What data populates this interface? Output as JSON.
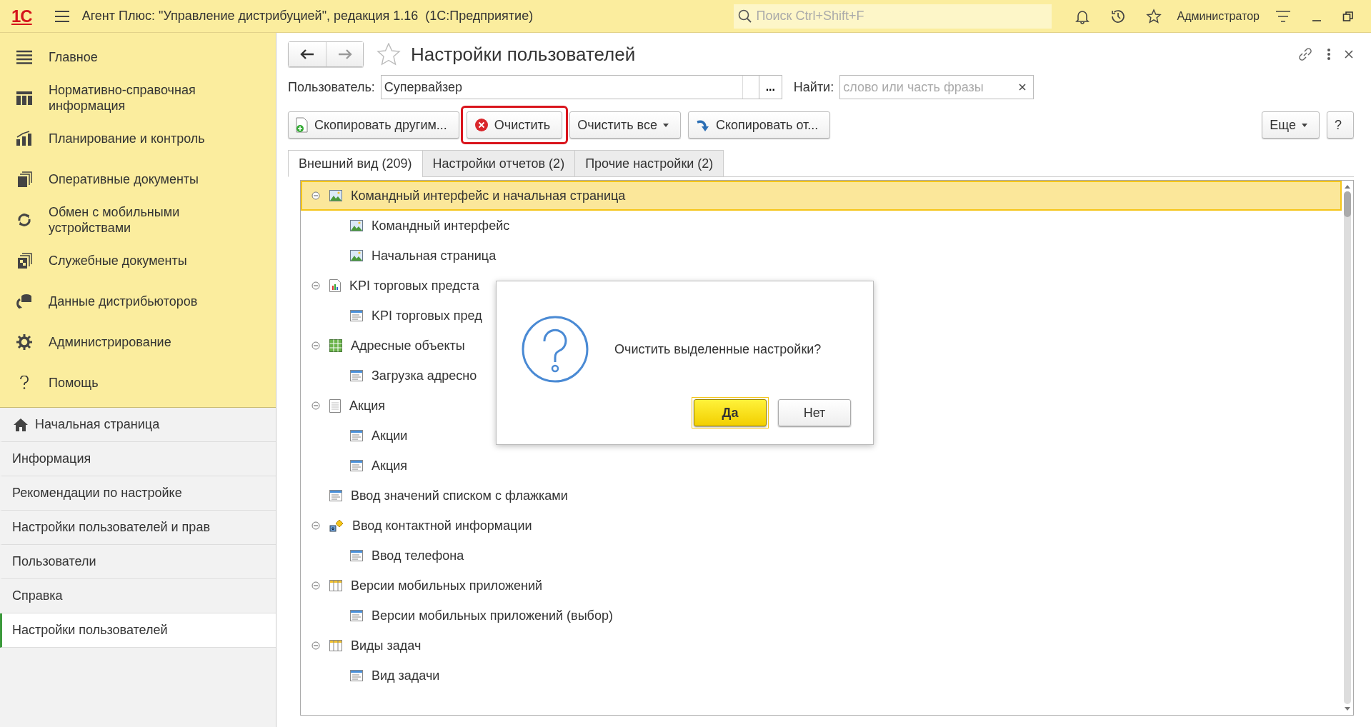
{
  "topbar": {
    "logo": "1С",
    "title": "Агент Плюс: \"Управление дистрибуцией\", редакция 1.16  (1С:Предприятие)",
    "search_placeholder": "Поиск Ctrl+Shift+F",
    "user": "Администратор"
  },
  "sections": [
    {
      "label": "Главное",
      "kind": "menu"
    },
    {
      "label": "Нормативно-справочная информация",
      "kind": "catalog"
    },
    {
      "label": "Планирование и контроль",
      "kind": "chart"
    },
    {
      "label": "Оперативные документы",
      "kind": "docs"
    },
    {
      "label": "Обмен с мобильными устройствами",
      "kind": "sync"
    },
    {
      "label": "Служебные документы",
      "kind": "service"
    },
    {
      "label": "Данные дистрибьюторов",
      "kind": "data"
    },
    {
      "label": "Администрирование",
      "kind": "gear"
    },
    {
      "label": "Помощь",
      "kind": "help"
    }
  ],
  "nav": [
    {
      "label": "Начальная страница",
      "kind": "home",
      "selected": false
    },
    {
      "label": "Информация",
      "kind": "plain",
      "selected": false
    },
    {
      "label": "Рекомендации по настройке",
      "kind": "plain",
      "selected": false
    },
    {
      "label": "Настройки пользователей и прав",
      "kind": "plain",
      "selected": false
    },
    {
      "label": "Пользователи",
      "kind": "plain",
      "selected": false
    },
    {
      "label": "Справка",
      "kind": "plain",
      "selected": false
    },
    {
      "label": "Настройки пользователей",
      "kind": "plain",
      "selected": true
    }
  ],
  "page": {
    "title": "Настройки пользователей",
    "user_label": "Пользователь:",
    "user_value": "Супервайзер",
    "select_button": "...",
    "find_label": "Найти:",
    "find_placeholder": "слово или часть фразы"
  },
  "toolbar": [
    {
      "label": "Скопировать другим...",
      "kind": "copy-to",
      "dropdown": false,
      "highlighted": false
    },
    {
      "label": "Очистить",
      "kind": "clear",
      "dropdown": false,
      "highlighted": true
    },
    {
      "label": "Очистить все",
      "kind": "plain",
      "dropdown": true,
      "highlighted": false
    },
    {
      "label": "Скопировать от...",
      "kind": "copy-from",
      "dropdown": false,
      "highlighted": false
    }
  ],
  "toolbar_right": [
    {
      "label": "Еще",
      "dropdown": true
    },
    {
      "label": "?",
      "dropdown": false
    }
  ],
  "tabs": [
    {
      "label": "Внешний вид (209)",
      "selected": true
    },
    {
      "label": "Настройки отчетов (2)",
      "selected": false
    },
    {
      "label": "Прочие настройки (2)",
      "selected": false
    }
  ],
  "tree": [
    {
      "label": "Командный интерфейс и начальная страница",
      "kind": "picture",
      "selected": true,
      "expanded": true,
      "children": [
        {
          "label": "Командный интерфейс",
          "kind": "picture",
          "selected": false
        },
        {
          "label": "Начальная страница",
          "kind": "picture",
          "selected": false
        }
      ]
    },
    {
      "label": "KPI торговых предста",
      "kind": "report",
      "selected": false,
      "expanded": true,
      "children": [
        {
          "label": "KPI торговых пред",
          "kind": "form",
          "selected": false
        }
      ]
    },
    {
      "label": "Адресные объекты",
      "kind": "grid",
      "selected": false,
      "expanded": true,
      "children": [
        {
          "label": "Загрузка адресно",
          "kind": "form",
          "selected": false
        }
      ]
    },
    {
      "label": "Акция",
      "kind": "document",
      "selected": false,
      "expanded": true,
      "children": [
        {
          "label": "Акции",
          "kind": "form",
          "selected": false
        },
        {
          "label": "Акция",
          "kind": "form",
          "selected": false
        }
      ]
    },
    {
      "label": "Ввод значений списком с флажками",
      "kind": "form",
      "selected": false
    },
    {
      "label": "Ввод контактной информации",
      "kind": "contact",
      "selected": false,
      "expanded": true,
      "children": [
        {
          "label": "Ввод телефона",
          "kind": "form",
          "selected": false
        }
      ]
    },
    {
      "label": "Версии мобильных приложений",
      "kind": "table",
      "selected": false,
      "expanded": true,
      "children": [
        {
          "label": "Версии мобильных приложений (выбор)",
          "kind": "form",
          "selected": false
        }
      ]
    },
    {
      "label": "Виды задач",
      "kind": "table",
      "selected": false,
      "expanded": true,
      "children": [
        {
          "label": "Вид задачи",
          "kind": "form",
          "selected": false
        }
      ]
    }
  ],
  "dialog": {
    "question": "Очистить выделенные настройки?",
    "buttons": [
      {
        "label": "Да",
        "default": true
      },
      {
        "label": "Нет",
        "default": false
      }
    ]
  }
}
